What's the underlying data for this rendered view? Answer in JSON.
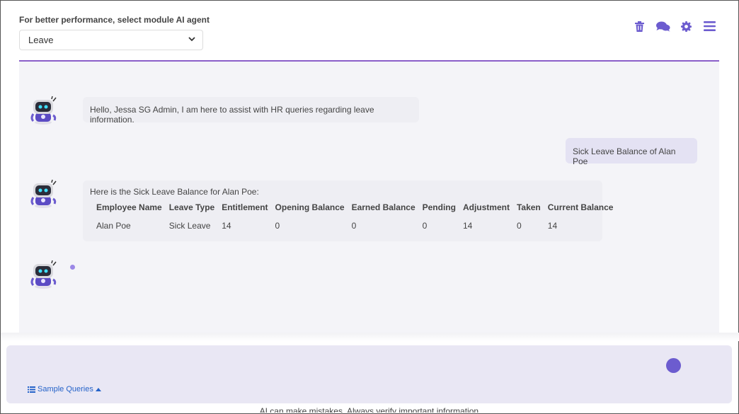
{
  "header": {
    "module_label": "For better performance, select module AI agent",
    "module_selected": "Leave",
    "toolbar_icons": [
      "trash-icon",
      "chat-icon",
      "gear-icon",
      "menu-icon"
    ],
    "accent_color": "#6c5ccf"
  },
  "chat": {
    "greeting": "Hello, Jessa SG Admin, I am here to assist with HR queries regarding leave information.",
    "user_message": "Sick Leave Balance of Alan Poe",
    "response_intro": "Here is the Sick Leave Balance for Alan Poe:",
    "table": {
      "headers": [
        "Employee Name",
        "Leave Type",
        "Entitlement",
        "Opening Balance",
        "Earned Balance",
        "Pending",
        "Adjustment",
        "Taken",
        "Current Balance"
      ],
      "rows": [
        [
          "Alan Poe",
          "Sick Leave",
          "14",
          "0",
          "0",
          "0",
          "14",
          "0",
          "14"
        ]
      ]
    }
  },
  "input": {
    "sample_queries_label": "Sample Queries"
  },
  "footer": {
    "disclaimer": "AI can make mistakes. Always verify important information."
  }
}
